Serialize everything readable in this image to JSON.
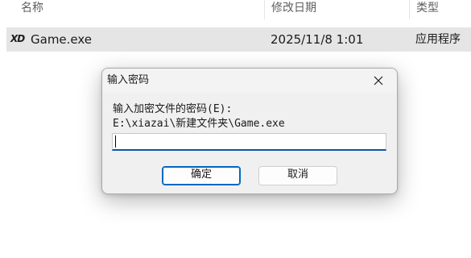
{
  "columns": {
    "name": "名称",
    "date": "修改日期",
    "type": "类型"
  },
  "file": {
    "icon_text": "XD",
    "name": "Game.exe",
    "date": "2025/11/8 1:01",
    "type": "应用程序"
  },
  "dialog": {
    "title": "输入密码",
    "prompt": "输入加密文件的密码(E):",
    "path": "E:\\xiazai\\新建文件夹\\Game.exe",
    "password_value": "",
    "ok_label": "确定",
    "cancel_label": "取消"
  },
  "colors": {
    "selection": "#e5e5e5",
    "accent": "#0067c0",
    "dialog_bg": "#f0f0f0"
  }
}
